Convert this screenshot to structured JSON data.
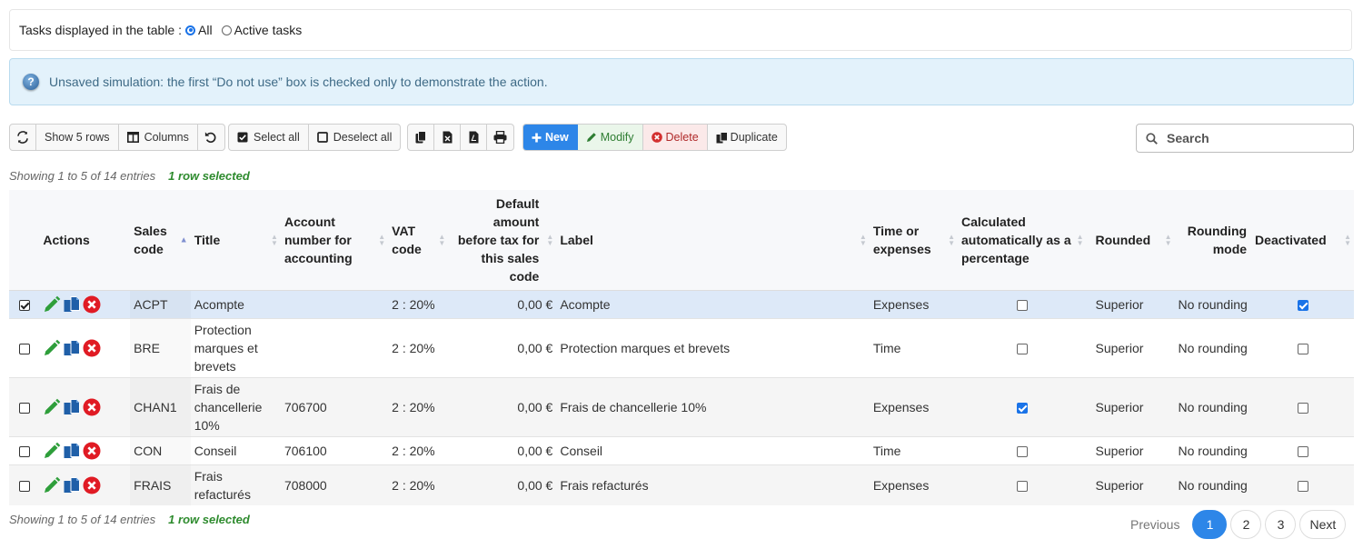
{
  "filter": {
    "label": "Tasks displayed in the table :",
    "options": [
      {
        "label": "All",
        "checked": true
      },
      {
        "label": "Active tasks",
        "checked": false
      }
    ]
  },
  "notice": {
    "icon": "help-icon",
    "text": "Unsaved simulation: the first “Do not use” box is checked only to demonstrate the action."
  },
  "toolbar": {
    "refresh_icon": "refresh-icon",
    "show_rows": "Show 5 rows",
    "columns": "Columns",
    "reset_icon": "undo-icon",
    "select_all": "Select all",
    "deselect_all": "Deselect all",
    "copy_icon": "copy-icon",
    "excel_icon": "excel-icon",
    "pdf_icon": "pdf-icon",
    "print_icon": "print-icon",
    "new": "New",
    "modify": "Modify",
    "delete": "Delete",
    "duplicate": "Duplicate"
  },
  "search": {
    "placeholder": "Search",
    "value": ""
  },
  "info_top": {
    "text": "Showing 1 to 5 of 14 entries",
    "selected": "1 row selected"
  },
  "info_bottom": {
    "text": "Showing 1 to 5 of 14 entries",
    "selected": "1 row selected"
  },
  "table": {
    "headers": {
      "actions": "Actions",
      "sales_code": "Sales code",
      "title": "Title",
      "account": "Account number for accounting",
      "vat": "VAT code",
      "default_amount": "Default amount before tax for this sales code",
      "label": "Label",
      "time_exp": "Time or expenses",
      "calc_pct": "Calculated automatically as a percentage",
      "rounded": "Rounded",
      "rounding_mode": "Rounding mode",
      "deactivated": "Deactivated"
    },
    "rows": [
      {
        "selected": true,
        "code": "ACPT",
        "title": "Acompte",
        "account": "",
        "vat": "2 : 20%",
        "amount": "0,00 €",
        "label": "Acompte",
        "time_exp": "Expenses",
        "calc_pct": false,
        "rounded": "Superior",
        "rounding_mode": "No rounding",
        "deactivated": true
      },
      {
        "selected": false,
        "code": "BRE",
        "title": "Protection marques et brevets",
        "account": "",
        "vat": "2 : 20%",
        "amount": "0,00 €",
        "label": "Protection marques et brevets",
        "time_exp": "Time",
        "calc_pct": false,
        "rounded": "Superior",
        "rounding_mode": "No rounding",
        "deactivated": false
      },
      {
        "selected": false,
        "code": "CHAN1",
        "title": "Frais de chancellerie 10%",
        "account": "706700",
        "vat": "2 : 20%",
        "amount": "0,00 €",
        "label": "Frais de chancellerie 10%",
        "time_exp": "Expenses",
        "calc_pct": true,
        "rounded": "Superior",
        "rounding_mode": "No rounding",
        "deactivated": false
      },
      {
        "selected": false,
        "code": "CON",
        "title": "Conseil",
        "account": "706100",
        "vat": "2 : 20%",
        "amount": "0,00 €",
        "label": "Conseil",
        "time_exp": "Time",
        "calc_pct": false,
        "rounded": "Superior",
        "rounding_mode": "No rounding",
        "deactivated": false
      },
      {
        "selected": false,
        "code": "FRAIS",
        "title": "Frais refacturés",
        "account": "708000",
        "vat": "2 : 20%",
        "amount": "0,00 €",
        "label": "Frais refacturés",
        "time_exp": "Expenses",
        "calc_pct": false,
        "rounded": "Superior",
        "rounding_mode": "No rounding",
        "deactivated": false
      }
    ]
  },
  "pagination": {
    "previous": "Previous",
    "pages": [
      "1",
      "2",
      "3"
    ],
    "current": "1",
    "next": "Next"
  },
  "colors": {
    "accent": "#2d86e8",
    "selected_row": "#dde9f8",
    "info_bg": "#e3f2fb",
    "success_text": "#2e8b2e",
    "danger": "#d32f2f"
  }
}
